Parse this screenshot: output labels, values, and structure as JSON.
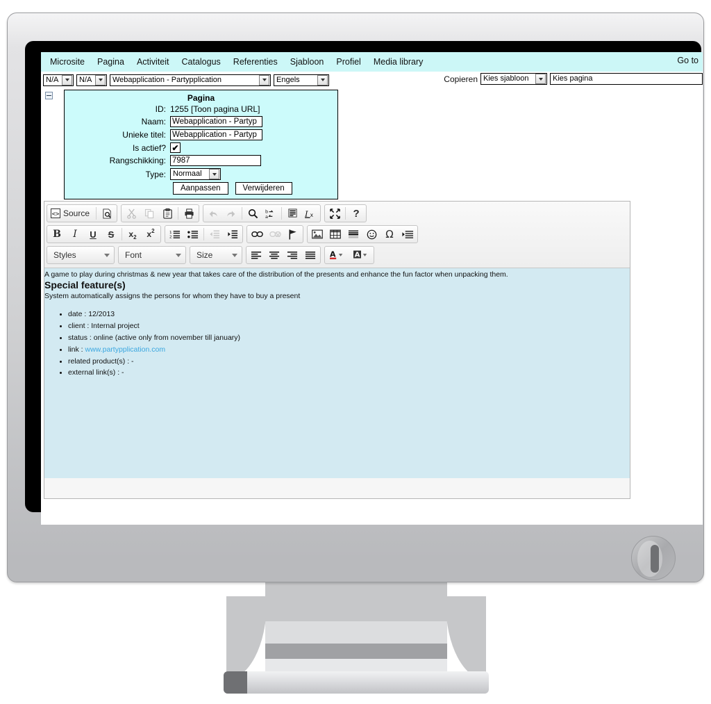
{
  "topnav": {
    "items": [
      {
        "label": "Microsite"
      },
      {
        "label": "Pagina"
      },
      {
        "label": "Activiteit"
      },
      {
        "label": "Catalogus"
      },
      {
        "label": "Referenties"
      },
      {
        "label": "Sjabloon"
      },
      {
        "label": "Profiel"
      },
      {
        "label": "Media library"
      }
    ],
    "goto": "Go to"
  },
  "selectbar": {
    "site_select": "N/A",
    "section_select": "N/A",
    "page_select": "Webapplication - Partypplication",
    "language_select": "Engels",
    "copy_label": "Copieren",
    "template_select": "Kies sjabloon",
    "page_input_placeholder": "Kies pagina",
    "page_input_value": "Kies pagina"
  },
  "page_form": {
    "title": "Pagina",
    "id_label": "ID:",
    "id_value": "1255 [Toon pagina URL]",
    "naam_label": "Naam:",
    "naam_value": "Webapplication - Partyp",
    "unieke_titel_label": "Unieke titel:",
    "unieke_titel_value": "Webapplication - Partyp",
    "is_actief_label": "Is actief?",
    "is_actief_checked": "✔",
    "rangschikking_label": "Rangschikking:",
    "rangschikking_value": "7987",
    "type_label": "Type:",
    "type_value": "Normaal",
    "save_button": "Aanpassen",
    "delete_button": "Verwijderen"
  },
  "editor": {
    "toolbar": {
      "row1": [
        {
          "name": "source",
          "label": "Source"
        },
        {
          "name": "preview",
          "label": ""
        },
        {
          "name": "cut",
          "label": ""
        },
        {
          "name": "copy",
          "label": ""
        },
        {
          "name": "paste",
          "label": ""
        },
        {
          "name": "print",
          "label": ""
        },
        {
          "name": "undo",
          "label": ""
        },
        {
          "name": "redo",
          "label": ""
        },
        {
          "name": "find",
          "label": ""
        },
        {
          "name": "replace",
          "label": ""
        },
        {
          "name": "select-all",
          "label": ""
        },
        {
          "name": "remove-format",
          "label": ""
        },
        {
          "name": "maximize",
          "label": ""
        },
        {
          "name": "about",
          "label": "?"
        }
      ],
      "row2": [
        {
          "name": "bold",
          "label": "B"
        },
        {
          "name": "italic",
          "label": "I"
        },
        {
          "name": "underline",
          "label": "U"
        },
        {
          "name": "strike",
          "label": "S"
        },
        {
          "name": "subscript",
          "label": "x"
        },
        {
          "name": "superscript",
          "label": "x"
        },
        {
          "name": "numbered-list",
          "label": ""
        },
        {
          "name": "bulleted-list",
          "label": ""
        },
        {
          "name": "outdent",
          "label": ""
        },
        {
          "name": "indent",
          "label": ""
        },
        {
          "name": "link",
          "label": ""
        },
        {
          "name": "unlink",
          "label": ""
        },
        {
          "name": "anchor",
          "label": ""
        },
        {
          "name": "image",
          "label": ""
        },
        {
          "name": "table",
          "label": ""
        },
        {
          "name": "horizontal-rule",
          "label": ""
        },
        {
          "name": "smiley",
          "label": ""
        },
        {
          "name": "special-character",
          "label": "Ω"
        },
        {
          "name": "page-break",
          "label": ""
        }
      ],
      "styles_combo": "Styles",
      "font_combo": "Font",
      "size_combo": "Size",
      "align": [
        "align-left",
        "align-center",
        "align-right",
        "justify"
      ],
      "colors": [
        "text-color",
        "background-color"
      ]
    },
    "content": {
      "intro": "A game to play during christmas & new year that takes care of the distribution of the presents and enhance the fun factor when unpacking them.",
      "heading": "Special feature(s)",
      "subtext": "System automatically assigns the persons for whom they have to buy a present",
      "list": [
        {
          "text": "date : 12/2013"
        },
        {
          "text": "client : Internal project"
        },
        {
          "text": "status : online (active only from november till january)"
        },
        {
          "text": "link : ",
          "link": "www.partypplication.com"
        },
        {
          "text": "related product(s) : -"
        },
        {
          "text": "external link(s) : -"
        }
      ]
    }
  },
  "colors": {
    "nav_background": "#ccf7f7",
    "panel_background": "#ccfbfb",
    "editor_background": "#d3eaf2",
    "link": "#3ba7e0",
    "bezel": "#000000"
  }
}
